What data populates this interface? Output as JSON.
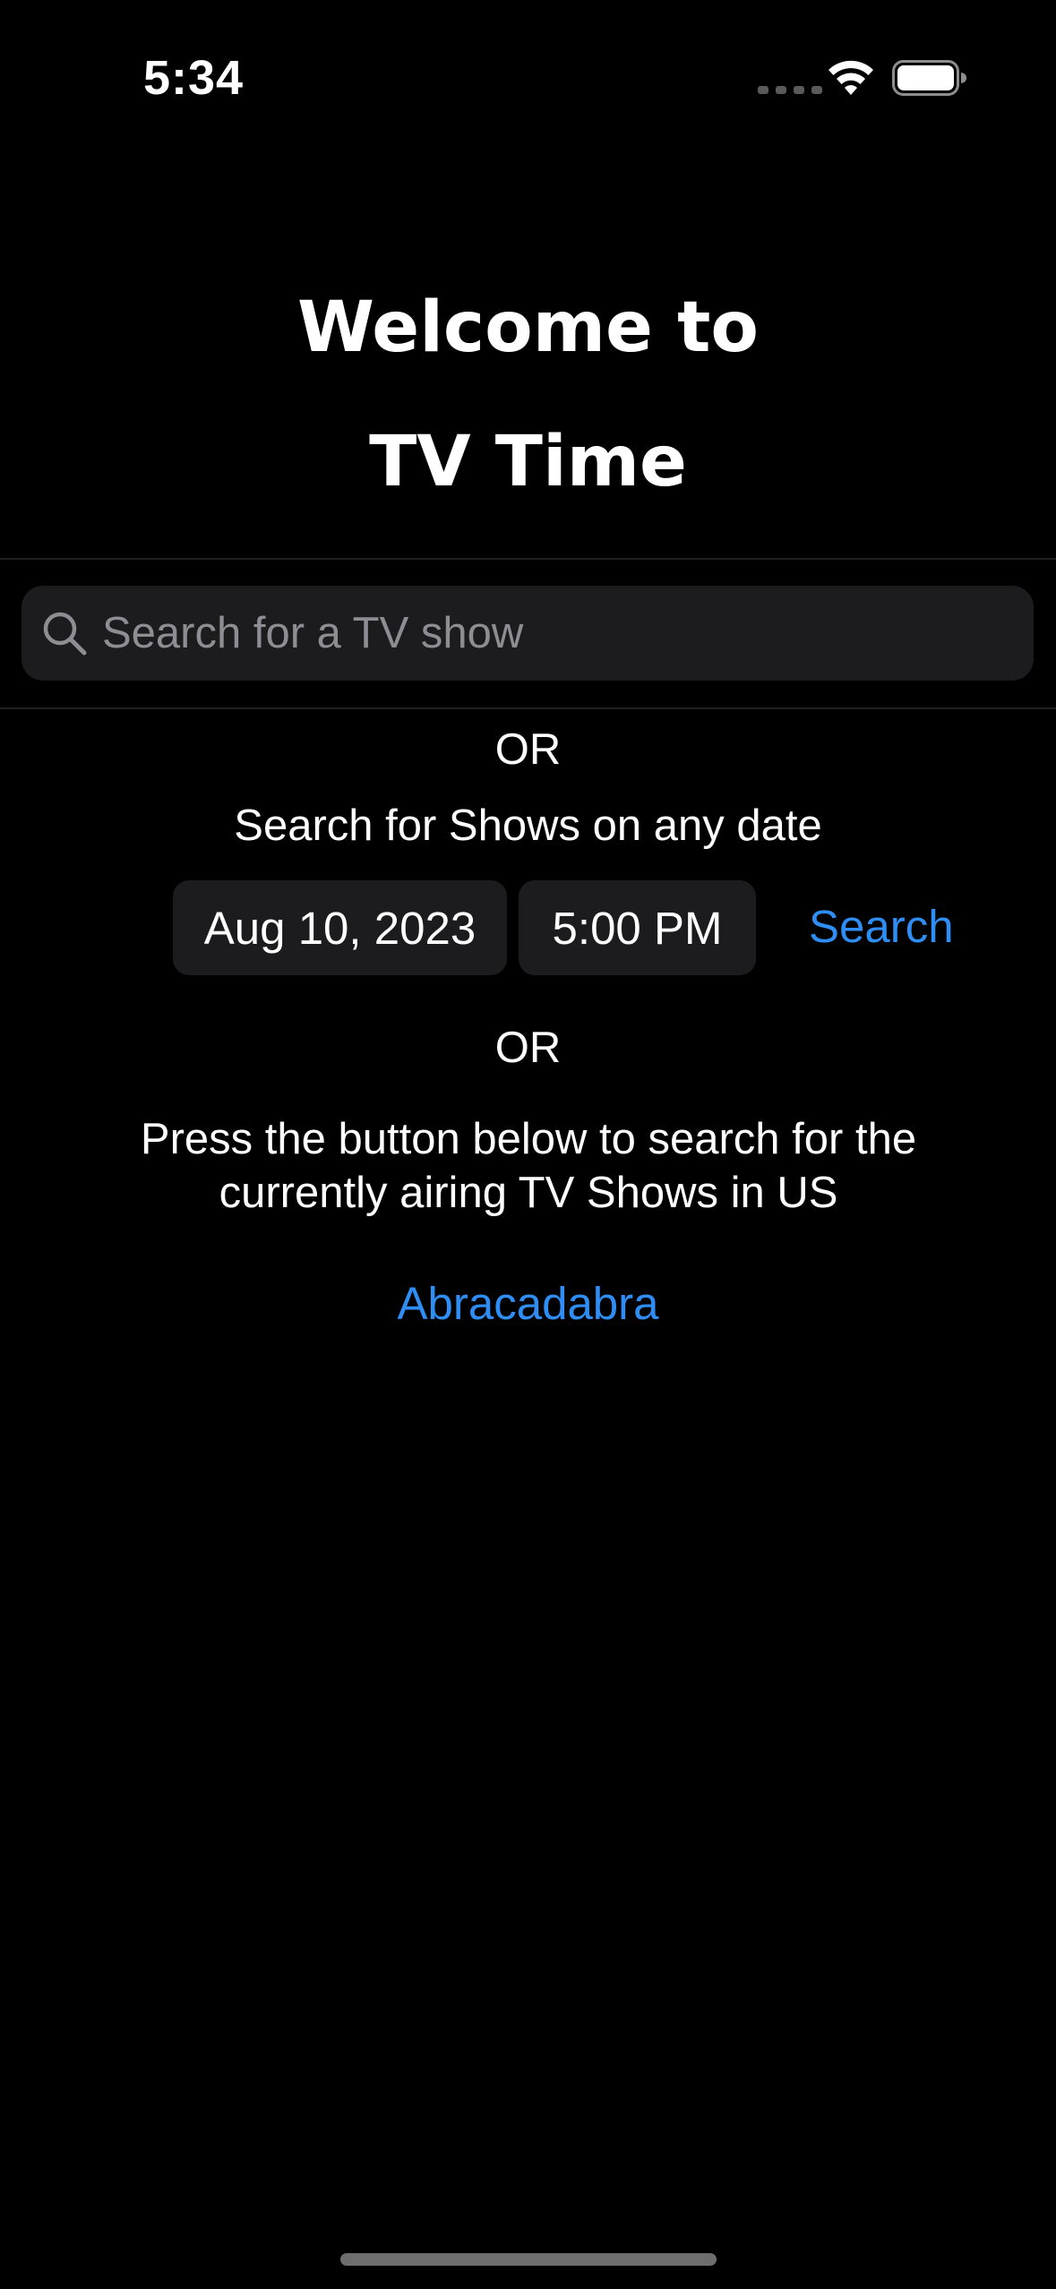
{
  "status_bar": {
    "time": "5:34",
    "icons": [
      "cellular-signal-icon",
      "wifi-icon",
      "battery-icon"
    ]
  },
  "welcome": {
    "line1": "Welcome to",
    "line2": "TV Time"
  },
  "search": {
    "placeholder": "Search for a TV show",
    "value": "",
    "icon": "search-icon"
  },
  "or_1": "OR",
  "date_search": {
    "label": "Search for Shows on any date",
    "date": "Aug 10, 2023",
    "time": "5:00 PM",
    "button_label": "Search"
  },
  "or_2": "OR",
  "airing": {
    "description": "Press the button below to search for the currently airing TV Shows in US",
    "button_label": "Abracadabra"
  },
  "colors": {
    "background": "#000000",
    "accent": "#2f8ef5",
    "field_background": "#1c1c1e",
    "placeholder": "#8d8d93"
  }
}
